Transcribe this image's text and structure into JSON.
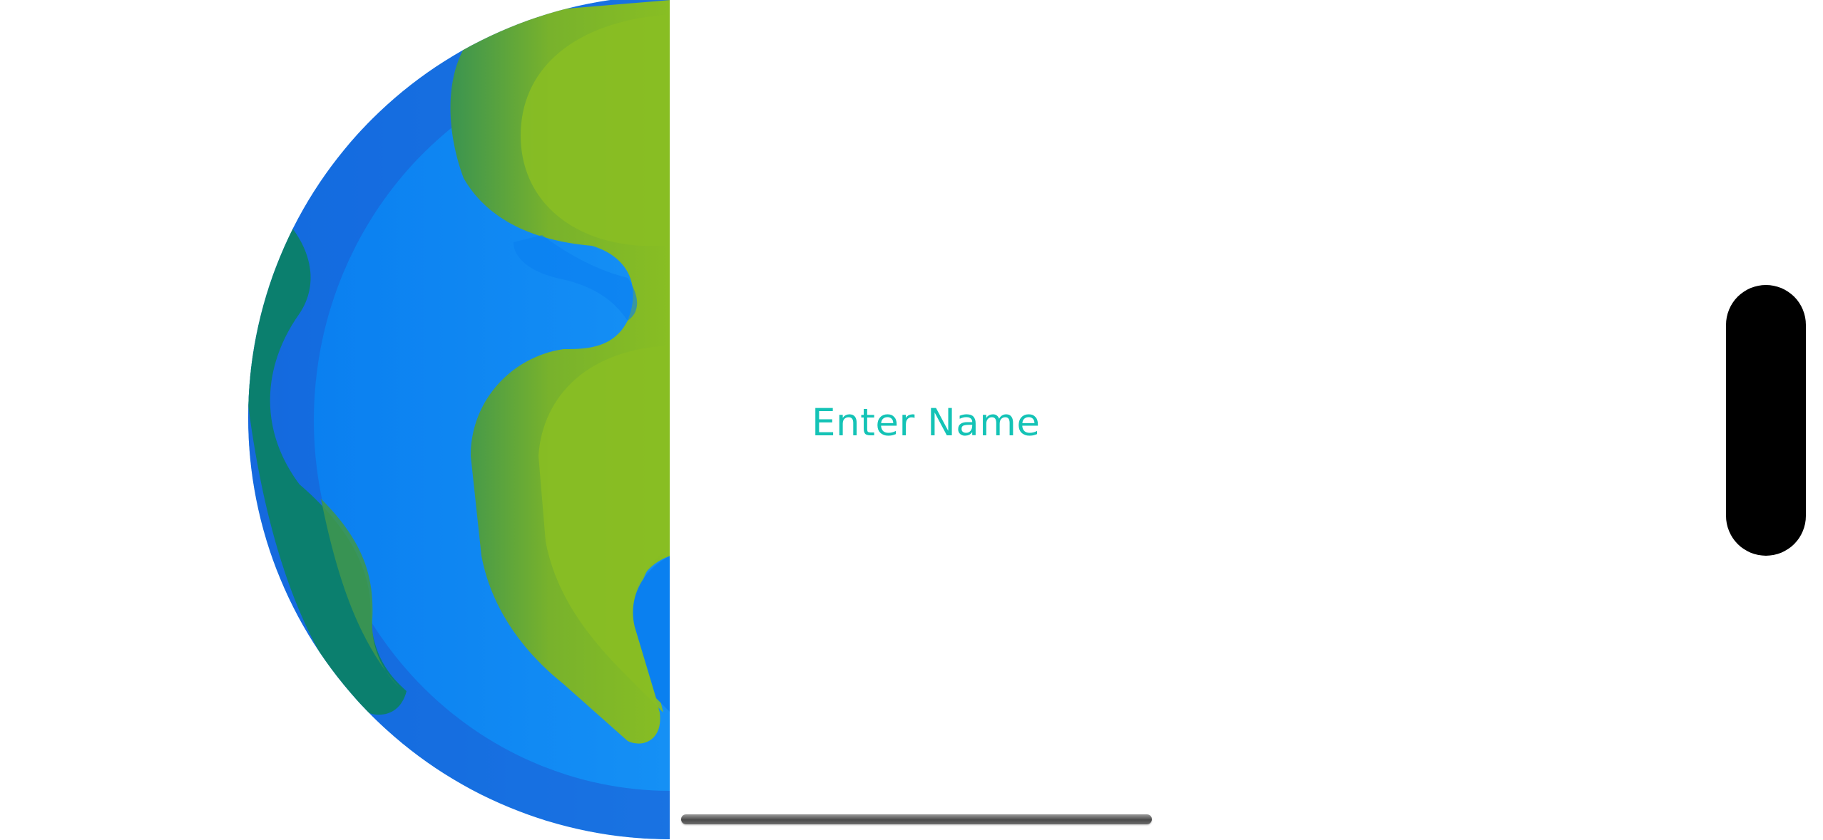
{
  "name_field": {
    "placeholder": "Enter Name",
    "placeholder_color": "#14c3b6"
  },
  "globe": {
    "icon": "earth-globe-icon",
    "ocean_color": "#0a7ff0",
    "land_color": "#86bc24",
    "coast_color": "#0b7f6e"
  },
  "home_indicator": {
    "icon": "home-indicator-bar"
  },
  "side_control": {
    "icon": "side-pill-handle",
    "color": "#000000"
  }
}
